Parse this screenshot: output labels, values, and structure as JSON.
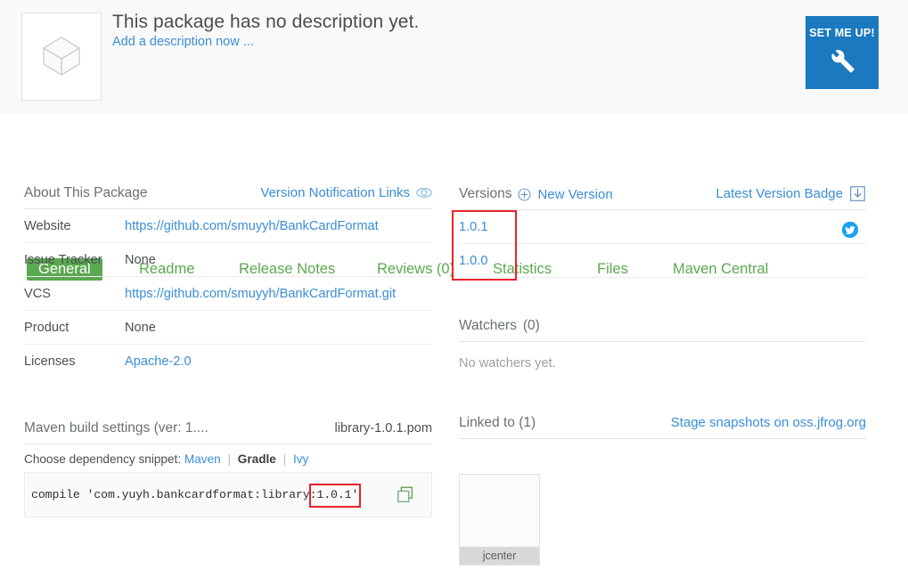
{
  "header": {
    "title": "This package has no description yet.",
    "add_description_link": "Add a description now ...",
    "set_me_up_label": "SET ME UP!",
    "thumb_icon": "package-cube-icon",
    "wrench_icon": "wrench-icon"
  },
  "tabs": [
    {
      "label": "General",
      "active": true
    },
    {
      "label": "Readme",
      "active": false
    },
    {
      "label": "Release Notes",
      "active": false
    },
    {
      "label": "Reviews (0)",
      "active": false
    },
    {
      "label": "Statistics",
      "active": false
    },
    {
      "label": "Files",
      "active": false
    },
    {
      "label": "Maven Central",
      "active": false
    }
  ],
  "about": {
    "heading": "About This Package",
    "version_notification_links": "Version Notification Links",
    "eye_icon": "eye-icon",
    "rows": [
      {
        "key": "Website",
        "value": "https://github.com/smuyyh/BankCardFormat",
        "is_link": true
      },
      {
        "key": "Issue Tracker",
        "value": "None",
        "is_link": false
      },
      {
        "key": "VCS",
        "value": "https://github.com/smuyyh/BankCardFormat.git",
        "is_link": true
      },
      {
        "key": "Product",
        "value": "None",
        "is_link": false
      },
      {
        "key": "Licenses",
        "value": "Apache-2.0",
        "is_link": true
      }
    ]
  },
  "versions": {
    "heading": "Versions",
    "new_version_label": "New Version",
    "plus_icon": "circle-plus-icon",
    "latest_version_badge": "Latest Version Badge",
    "download_icon": "download-badge-icon",
    "twitter_icon": "twitter-icon",
    "items": [
      {
        "version": "1.0.1"
      },
      {
        "version": "1.0.0"
      }
    ]
  },
  "watchers": {
    "heading": "Watchers",
    "count": "(0)",
    "empty_text": "No watchers yet."
  },
  "linked_to": {
    "heading": "Linked to (1)",
    "stage_link": "Stage snapshots on oss.jfrog.org",
    "repo_label": "jcenter"
  },
  "maven_build": {
    "heading": "Maven build settings (ver: 1....",
    "pom_name": "library-1.0.1.pom",
    "choose_label": "Choose dependency snippet:",
    "options": [
      {
        "label": "Maven",
        "selected": false
      },
      {
        "label": "Gradle",
        "selected": true
      },
      {
        "label": "Ivy",
        "selected": false
      }
    ],
    "separator": "|",
    "snippet_prefix": "compile 'com.yuyh.bankcardformat:library",
    "snippet_highlight": ":1.0.1'",
    "copy_icon": "copy-icon"
  },
  "colors": {
    "accent_green": "#5aa84f",
    "link_blue": "#3b8dd6",
    "button_blue": "#1c79c0",
    "annotation_red": "#e8222a",
    "twitter_blue": "#1da1f2"
  }
}
